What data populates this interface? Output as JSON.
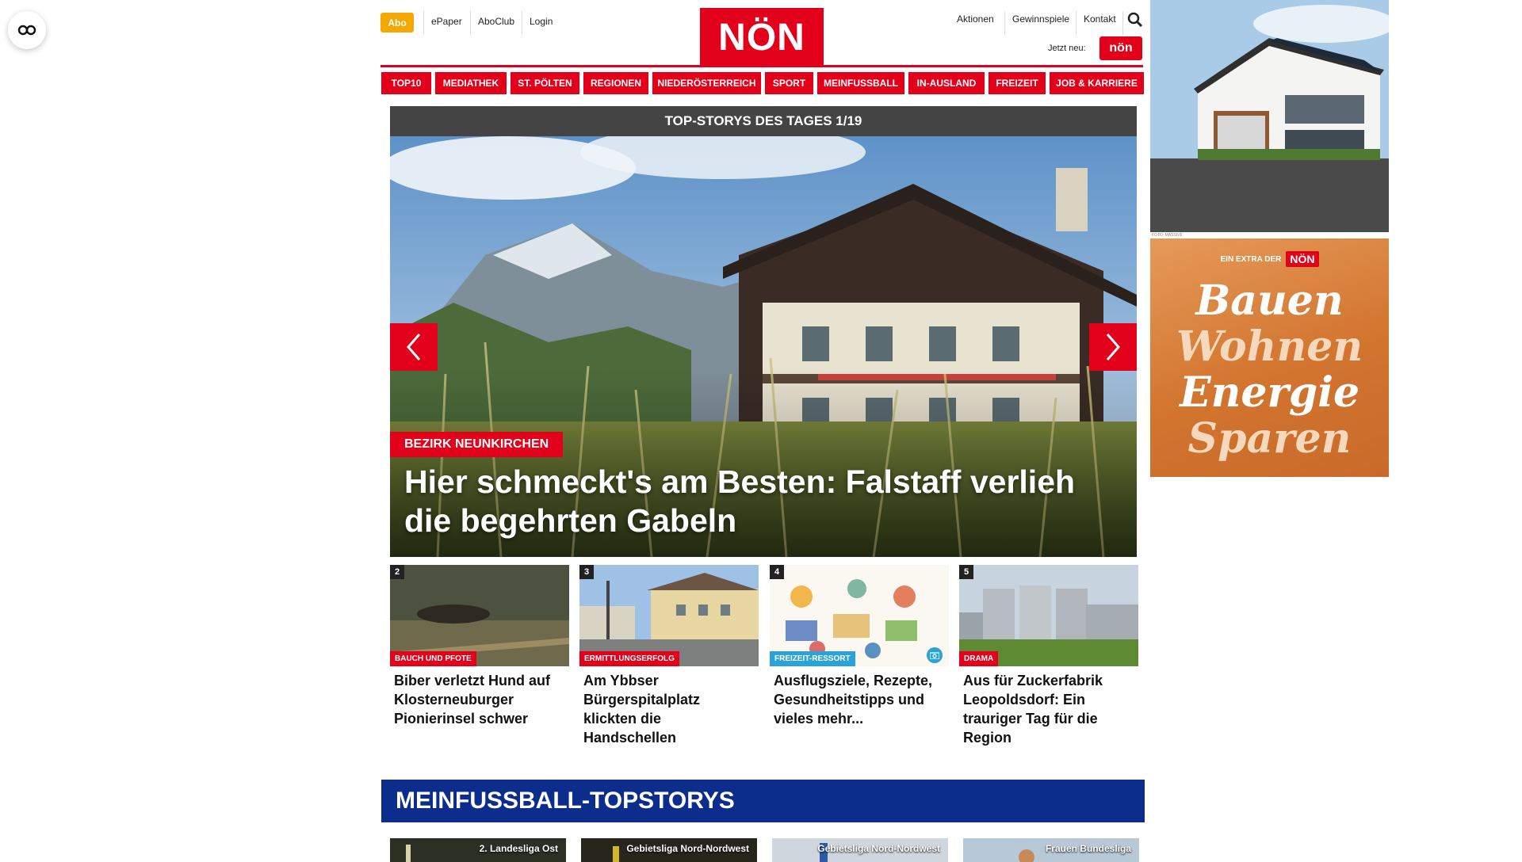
{
  "header": {
    "abo": "Abo",
    "epaper": "ePaper",
    "aboclub": "AboClub",
    "login": "Login",
    "logo": "NÖN",
    "aktionen": "Aktionen",
    "gewinnspiele": "Gewinnspiele",
    "kontakt": "Kontakt",
    "jetzt_neu": "Jetzt neu:",
    "mini_logo": "nön"
  },
  "nav": [
    "TOP10",
    "MEDIATHEK",
    "ST. PÖLTEN",
    "REGIONEN",
    "NIEDERÖSTERREICH",
    "SPORT",
    "MEINFUSSBALL",
    "IN-AUSLAND",
    "FREIZEIT",
    "JOB & KARRIERE"
  ],
  "hero": {
    "heading": "TOP-STORYS DES TAGES 1/19",
    "category": "BEZIRK NEUNKIRCHEN",
    "title": "Hier schmeckt's am Besten: Falstaff verlieh die begehrten Gabeln"
  },
  "cards": [
    {
      "num": "2",
      "tag": "BAUCH UND PFOTE",
      "tag_color": "#e2001a",
      "title": "Biber verletzt Hund auf Klosterneuburger Pionierinsel schwer"
    },
    {
      "num": "3",
      "tag": "ERMITTLUNGSERFOLG",
      "tag_color": "#e2001a",
      "title": "Am Ybbser Bürgerspitalplatz klickten die Handschellen"
    },
    {
      "num": "4",
      "tag": "FREIZEIT-RESSORT",
      "tag_color": "#29a3d8",
      "title": "Ausflugsziele, Rezepte, Gesundheitstipps und vieles mehr..."
    },
    {
      "num": "5",
      "tag": "DRAMA",
      "tag_color": "#e2001a",
      "title": "Aus für Zuckerfabrik Leopoldsdorf: Ein trauriger Tag für die Region"
    }
  ],
  "section": {
    "title": "MEINFUSSBALL-TOPSTORYS",
    "labels": [
      "2. Landesliga Ost",
      "Gebietsliga Nord-Nordwest",
      "Gebietsliga Nord-Nordwest",
      "Frauen Bundesliga"
    ]
  },
  "ads": {
    "credit": "FOTO: MASSIVE",
    "extra": "EIN EXTRA DER",
    "extra_logo": "NÖN",
    "words": [
      "Bauen",
      "Wohnen",
      "Energie",
      "Sparen"
    ]
  }
}
